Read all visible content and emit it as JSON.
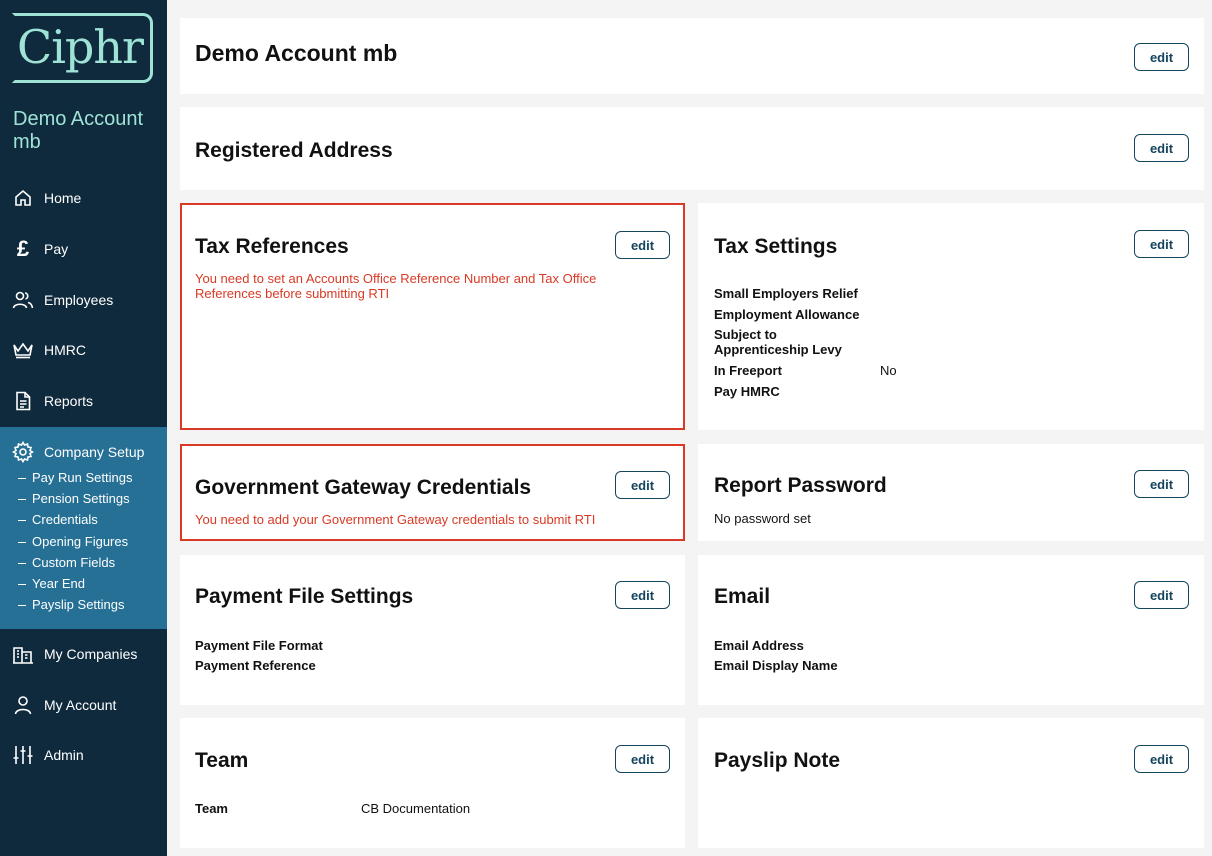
{
  "brand": {
    "logo_text": "Ciphr",
    "accent": "#9ee3d6",
    "sidebar_bg": "#102a3d",
    "active_bg": "#266f95",
    "error_color": "#d93a25"
  },
  "sidebar": {
    "account_name": "Demo Account mb",
    "nav": [
      {
        "label": "Home",
        "icon": "home-icon"
      },
      {
        "label": "Pay",
        "icon": "pound-icon"
      },
      {
        "label": "Employees",
        "icon": "users-icon"
      },
      {
        "label": "HMRC",
        "icon": "crown-icon"
      },
      {
        "label": "Reports",
        "icon": "document-icon"
      },
      {
        "label": "Company Setup",
        "icon": "gear-icon"
      },
      {
        "label": "My Companies",
        "icon": "building-icon"
      },
      {
        "label": "My Account",
        "icon": "user-icon"
      },
      {
        "label": "Admin",
        "icon": "sliders-icon"
      }
    ],
    "company_setup_items": [
      "Pay Run Settings",
      "Pension Settings",
      "Credentials",
      "Opening Figures",
      "Custom Fields",
      "Year End",
      "Payslip Settings"
    ]
  },
  "edit_label": "edit",
  "cards": {
    "account": {
      "title": "Demo Account mb"
    },
    "address": {
      "title": "Registered Address"
    },
    "tax_refs": {
      "title": "Tax References",
      "error": "You need to set an Accounts Office Reference Number and Tax Office References before submitting RTI"
    },
    "tax_settings": {
      "title": "Tax Settings",
      "fields": [
        {
          "label": "Small Employers Relief",
          "value": ""
        },
        {
          "label": "Employment Allowance",
          "value": ""
        },
        {
          "label": "Subject to Apprenticeship Levy",
          "value": ""
        },
        {
          "label": "In Freeport",
          "value": "No"
        },
        {
          "label": "Pay HMRC",
          "value": ""
        }
      ]
    },
    "gateway": {
      "title": "Government Gateway Credentials",
      "error": "You need to add your Government Gateway credentials to submit RTI"
    },
    "report_password": {
      "title": "Report Password",
      "text": "No password set"
    },
    "payment_file": {
      "title": "Payment File Settings",
      "fields": [
        {
          "label": "Payment File Format"
        },
        {
          "label": "Payment Reference"
        }
      ]
    },
    "email": {
      "title": "Email",
      "fields": [
        {
          "label": "Email Address"
        },
        {
          "label": "Email Display Name"
        }
      ]
    },
    "team": {
      "title": "Team",
      "fields": [
        {
          "label": "Team",
          "value": "CB Documentation"
        }
      ]
    },
    "payslip_note": {
      "title": "Payslip Note"
    }
  }
}
